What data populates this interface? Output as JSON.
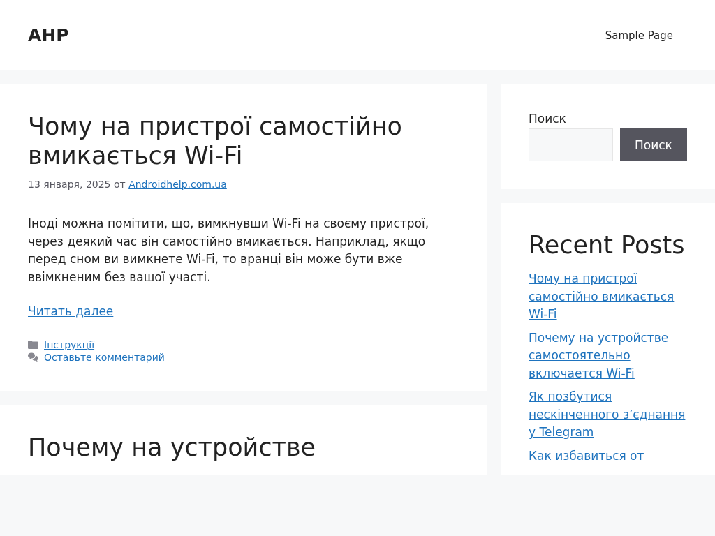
{
  "header": {
    "site_title": "AHP",
    "nav": [
      {
        "label": "Sample Page"
      }
    ]
  },
  "posts": [
    {
      "title": "Чому на пристрої самостійно вмикається Wi-Fi",
      "date": "13 января, 2025",
      "by": "от",
      "author": "Androidhelp.com.ua",
      "excerpt": "Іноді можна помітити, що, вимкнувши Wi-Fi на своєму пристрої, через деякий час він самостійно вмикається. Наприклад, якщо перед сном ви вимкнете Wi-Fi, то вранці він може бути вже ввімкненим без вашої участі.",
      "read_more": "Читать далее",
      "category": "Інструкції",
      "comments": "Оставьте комментарий"
    },
    {
      "title": "Почему на устройстве"
    }
  ],
  "sidebar": {
    "search": {
      "label": "Поиск",
      "button": "Поиск"
    },
    "recent_posts": {
      "title": "Recent Posts",
      "items": [
        "Чому на пристрої самостійно вмикається Wi-Fi",
        "Почему на устройстве самостоятельно включается Wi-Fi",
        "Як позбутися нескінченного з’єднання у Telegram",
        "Как избавиться от"
      ]
    }
  }
}
